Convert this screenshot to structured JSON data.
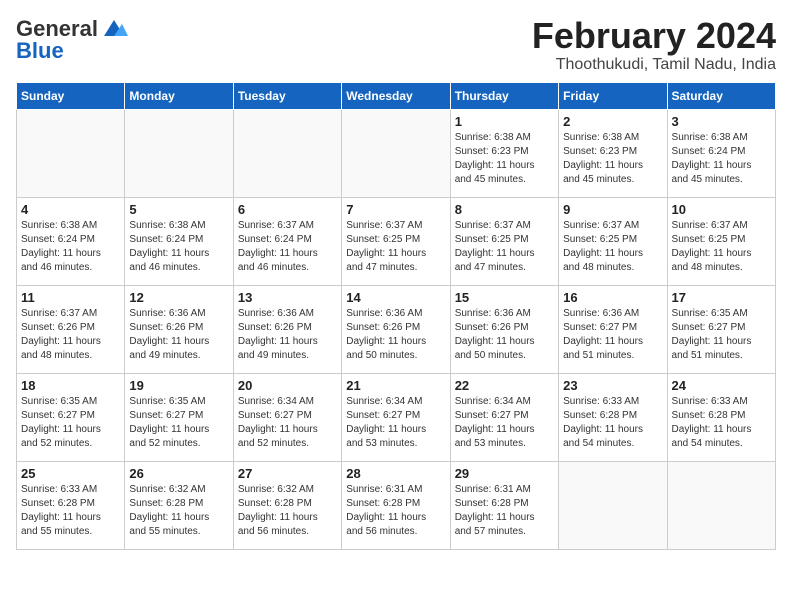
{
  "header": {
    "logo_general": "General",
    "logo_blue": "Blue",
    "title": "February 2024",
    "subtitle": "Thoothukudi, Tamil Nadu, India"
  },
  "days_of_week": [
    "Sunday",
    "Monday",
    "Tuesday",
    "Wednesday",
    "Thursday",
    "Friday",
    "Saturday"
  ],
  "weeks": [
    [
      {
        "day": "",
        "info": ""
      },
      {
        "day": "",
        "info": ""
      },
      {
        "day": "",
        "info": ""
      },
      {
        "day": "",
        "info": ""
      },
      {
        "day": "1",
        "info": "Sunrise: 6:38 AM\nSunset: 6:23 PM\nDaylight: 11 hours\nand 45 minutes."
      },
      {
        "day": "2",
        "info": "Sunrise: 6:38 AM\nSunset: 6:23 PM\nDaylight: 11 hours\nand 45 minutes."
      },
      {
        "day": "3",
        "info": "Sunrise: 6:38 AM\nSunset: 6:24 PM\nDaylight: 11 hours\nand 45 minutes."
      }
    ],
    [
      {
        "day": "4",
        "info": "Sunrise: 6:38 AM\nSunset: 6:24 PM\nDaylight: 11 hours\nand 46 minutes."
      },
      {
        "day": "5",
        "info": "Sunrise: 6:38 AM\nSunset: 6:24 PM\nDaylight: 11 hours\nand 46 minutes."
      },
      {
        "day": "6",
        "info": "Sunrise: 6:37 AM\nSunset: 6:24 PM\nDaylight: 11 hours\nand 46 minutes."
      },
      {
        "day": "7",
        "info": "Sunrise: 6:37 AM\nSunset: 6:25 PM\nDaylight: 11 hours\nand 47 minutes."
      },
      {
        "day": "8",
        "info": "Sunrise: 6:37 AM\nSunset: 6:25 PM\nDaylight: 11 hours\nand 47 minutes."
      },
      {
        "day": "9",
        "info": "Sunrise: 6:37 AM\nSunset: 6:25 PM\nDaylight: 11 hours\nand 48 minutes."
      },
      {
        "day": "10",
        "info": "Sunrise: 6:37 AM\nSunset: 6:25 PM\nDaylight: 11 hours\nand 48 minutes."
      }
    ],
    [
      {
        "day": "11",
        "info": "Sunrise: 6:37 AM\nSunset: 6:26 PM\nDaylight: 11 hours\nand 48 minutes."
      },
      {
        "day": "12",
        "info": "Sunrise: 6:36 AM\nSunset: 6:26 PM\nDaylight: 11 hours\nand 49 minutes."
      },
      {
        "day": "13",
        "info": "Sunrise: 6:36 AM\nSunset: 6:26 PM\nDaylight: 11 hours\nand 49 minutes."
      },
      {
        "day": "14",
        "info": "Sunrise: 6:36 AM\nSunset: 6:26 PM\nDaylight: 11 hours\nand 50 minutes."
      },
      {
        "day": "15",
        "info": "Sunrise: 6:36 AM\nSunset: 6:26 PM\nDaylight: 11 hours\nand 50 minutes."
      },
      {
        "day": "16",
        "info": "Sunrise: 6:36 AM\nSunset: 6:27 PM\nDaylight: 11 hours\nand 51 minutes."
      },
      {
        "day": "17",
        "info": "Sunrise: 6:35 AM\nSunset: 6:27 PM\nDaylight: 11 hours\nand 51 minutes."
      }
    ],
    [
      {
        "day": "18",
        "info": "Sunrise: 6:35 AM\nSunset: 6:27 PM\nDaylight: 11 hours\nand 52 minutes."
      },
      {
        "day": "19",
        "info": "Sunrise: 6:35 AM\nSunset: 6:27 PM\nDaylight: 11 hours\nand 52 minutes."
      },
      {
        "day": "20",
        "info": "Sunrise: 6:34 AM\nSunset: 6:27 PM\nDaylight: 11 hours\nand 52 minutes."
      },
      {
        "day": "21",
        "info": "Sunrise: 6:34 AM\nSunset: 6:27 PM\nDaylight: 11 hours\nand 53 minutes."
      },
      {
        "day": "22",
        "info": "Sunrise: 6:34 AM\nSunset: 6:27 PM\nDaylight: 11 hours\nand 53 minutes."
      },
      {
        "day": "23",
        "info": "Sunrise: 6:33 AM\nSunset: 6:28 PM\nDaylight: 11 hours\nand 54 minutes."
      },
      {
        "day": "24",
        "info": "Sunrise: 6:33 AM\nSunset: 6:28 PM\nDaylight: 11 hours\nand 54 minutes."
      }
    ],
    [
      {
        "day": "25",
        "info": "Sunrise: 6:33 AM\nSunset: 6:28 PM\nDaylight: 11 hours\nand 55 minutes."
      },
      {
        "day": "26",
        "info": "Sunrise: 6:32 AM\nSunset: 6:28 PM\nDaylight: 11 hours\nand 55 minutes."
      },
      {
        "day": "27",
        "info": "Sunrise: 6:32 AM\nSunset: 6:28 PM\nDaylight: 11 hours\nand 56 minutes."
      },
      {
        "day": "28",
        "info": "Sunrise: 6:31 AM\nSunset: 6:28 PM\nDaylight: 11 hours\nand 56 minutes."
      },
      {
        "day": "29",
        "info": "Sunrise: 6:31 AM\nSunset: 6:28 PM\nDaylight: 11 hours\nand 57 minutes."
      },
      {
        "day": "",
        "info": ""
      },
      {
        "day": "",
        "info": ""
      }
    ]
  ]
}
